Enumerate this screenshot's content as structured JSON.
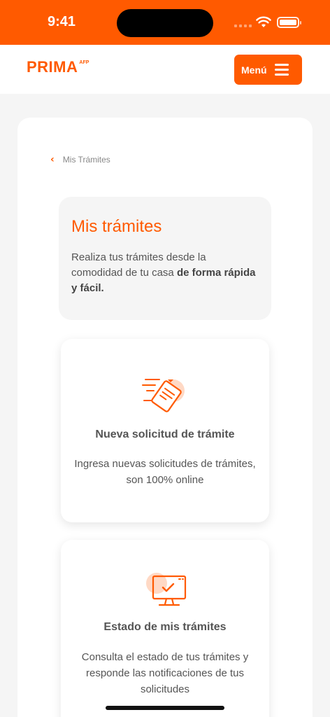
{
  "status_bar": {
    "time": "9:41"
  },
  "header": {
    "logo_text": "PRIMA",
    "logo_sup": "AFP",
    "menu_label": "Menú"
  },
  "breadcrumb": {
    "label": "Mis Trámites"
  },
  "intro": {
    "title": "Mis trámites",
    "desc_plain": "Realiza tus trámites desde la comodidad de tu casa ",
    "desc_bold": "de forma rápida y fácil."
  },
  "cards": [
    {
      "icon": "document-send-icon",
      "title": "Nueva solicitud de trámite",
      "desc": "Ingresa nuevas solicitudes de trámites, son 100% online"
    },
    {
      "icon": "monitor-check-icon",
      "title": "Estado de mis trámites",
      "desc": "Consulta el estado de tus trámites y responde las notificaciones de tus solicitudes"
    }
  ],
  "colors": {
    "brand_orange": "#ff5a00",
    "background": "#f5f5f5",
    "text_gray": "#555555"
  }
}
